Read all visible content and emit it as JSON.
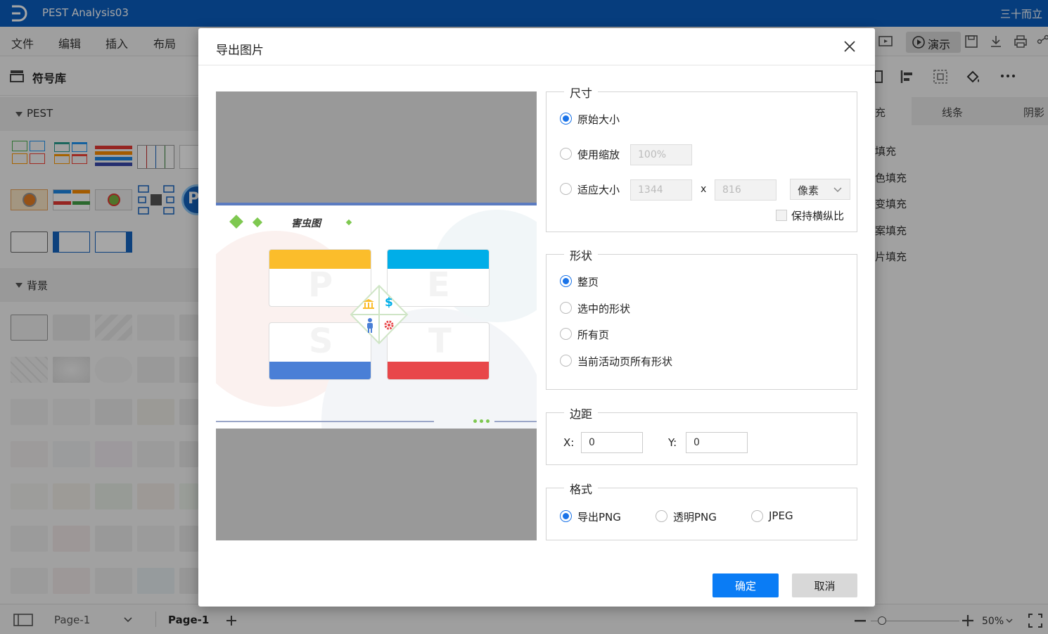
{
  "app": {
    "title": "PEST Analysis03",
    "user": "三十而立",
    "logo_icon": "d-logo-icon"
  },
  "menu": [
    "文件",
    "编辑",
    "插入",
    "布局"
  ],
  "toolbar": {
    "present_label": "演示"
  },
  "left_panel": {
    "title": "符号库",
    "section1": "PEST",
    "section2": "背景"
  },
  "right_panel": {
    "tabs": [
      "充",
      "线条",
      "阴影"
    ],
    "fill_options": [
      "填充",
      "色填充",
      "变填充",
      "案填充",
      "片填充"
    ]
  },
  "statusbar": {
    "page_select": "Page-1",
    "page_tab": "Page-1",
    "zoom": "50%"
  },
  "dialog": {
    "title": "导出图片",
    "size": {
      "legend": "尺寸",
      "original": "原始大小",
      "scale": "使用缩放",
      "scale_value": "100%",
      "fit": "适应大小",
      "width": "1344",
      "x_label": "x",
      "height": "816",
      "unit": "像素",
      "keep_ratio": "保持横纵比"
    },
    "shape": {
      "legend": "形状",
      "options": [
        "整页",
        "选中的形状",
        "所有页",
        "当前活动页所有形状"
      ]
    },
    "margin": {
      "legend": "边距",
      "x_label": "X:",
      "x_value": "0",
      "y_label": "Y:",
      "y_value": "0"
    },
    "format": {
      "legend": "格式",
      "options": [
        "导出PNG",
        "透明PNG",
        "JPEG"
      ]
    },
    "ok": "确定",
    "cancel": "取消"
  },
  "preview": {
    "slide_title": "害虫图",
    "letters": [
      "P",
      "E",
      "S",
      "T"
    ],
    "colors": {
      "yellow": "#fbbd2b",
      "blue": "#00aee8",
      "royal": "#4a7fd6",
      "red": "#e8474a",
      "green": "#7ec850"
    }
  },
  "colors": {
    "titlebar": "#0a5ec0",
    "primary": "#0a7cf5"
  }
}
